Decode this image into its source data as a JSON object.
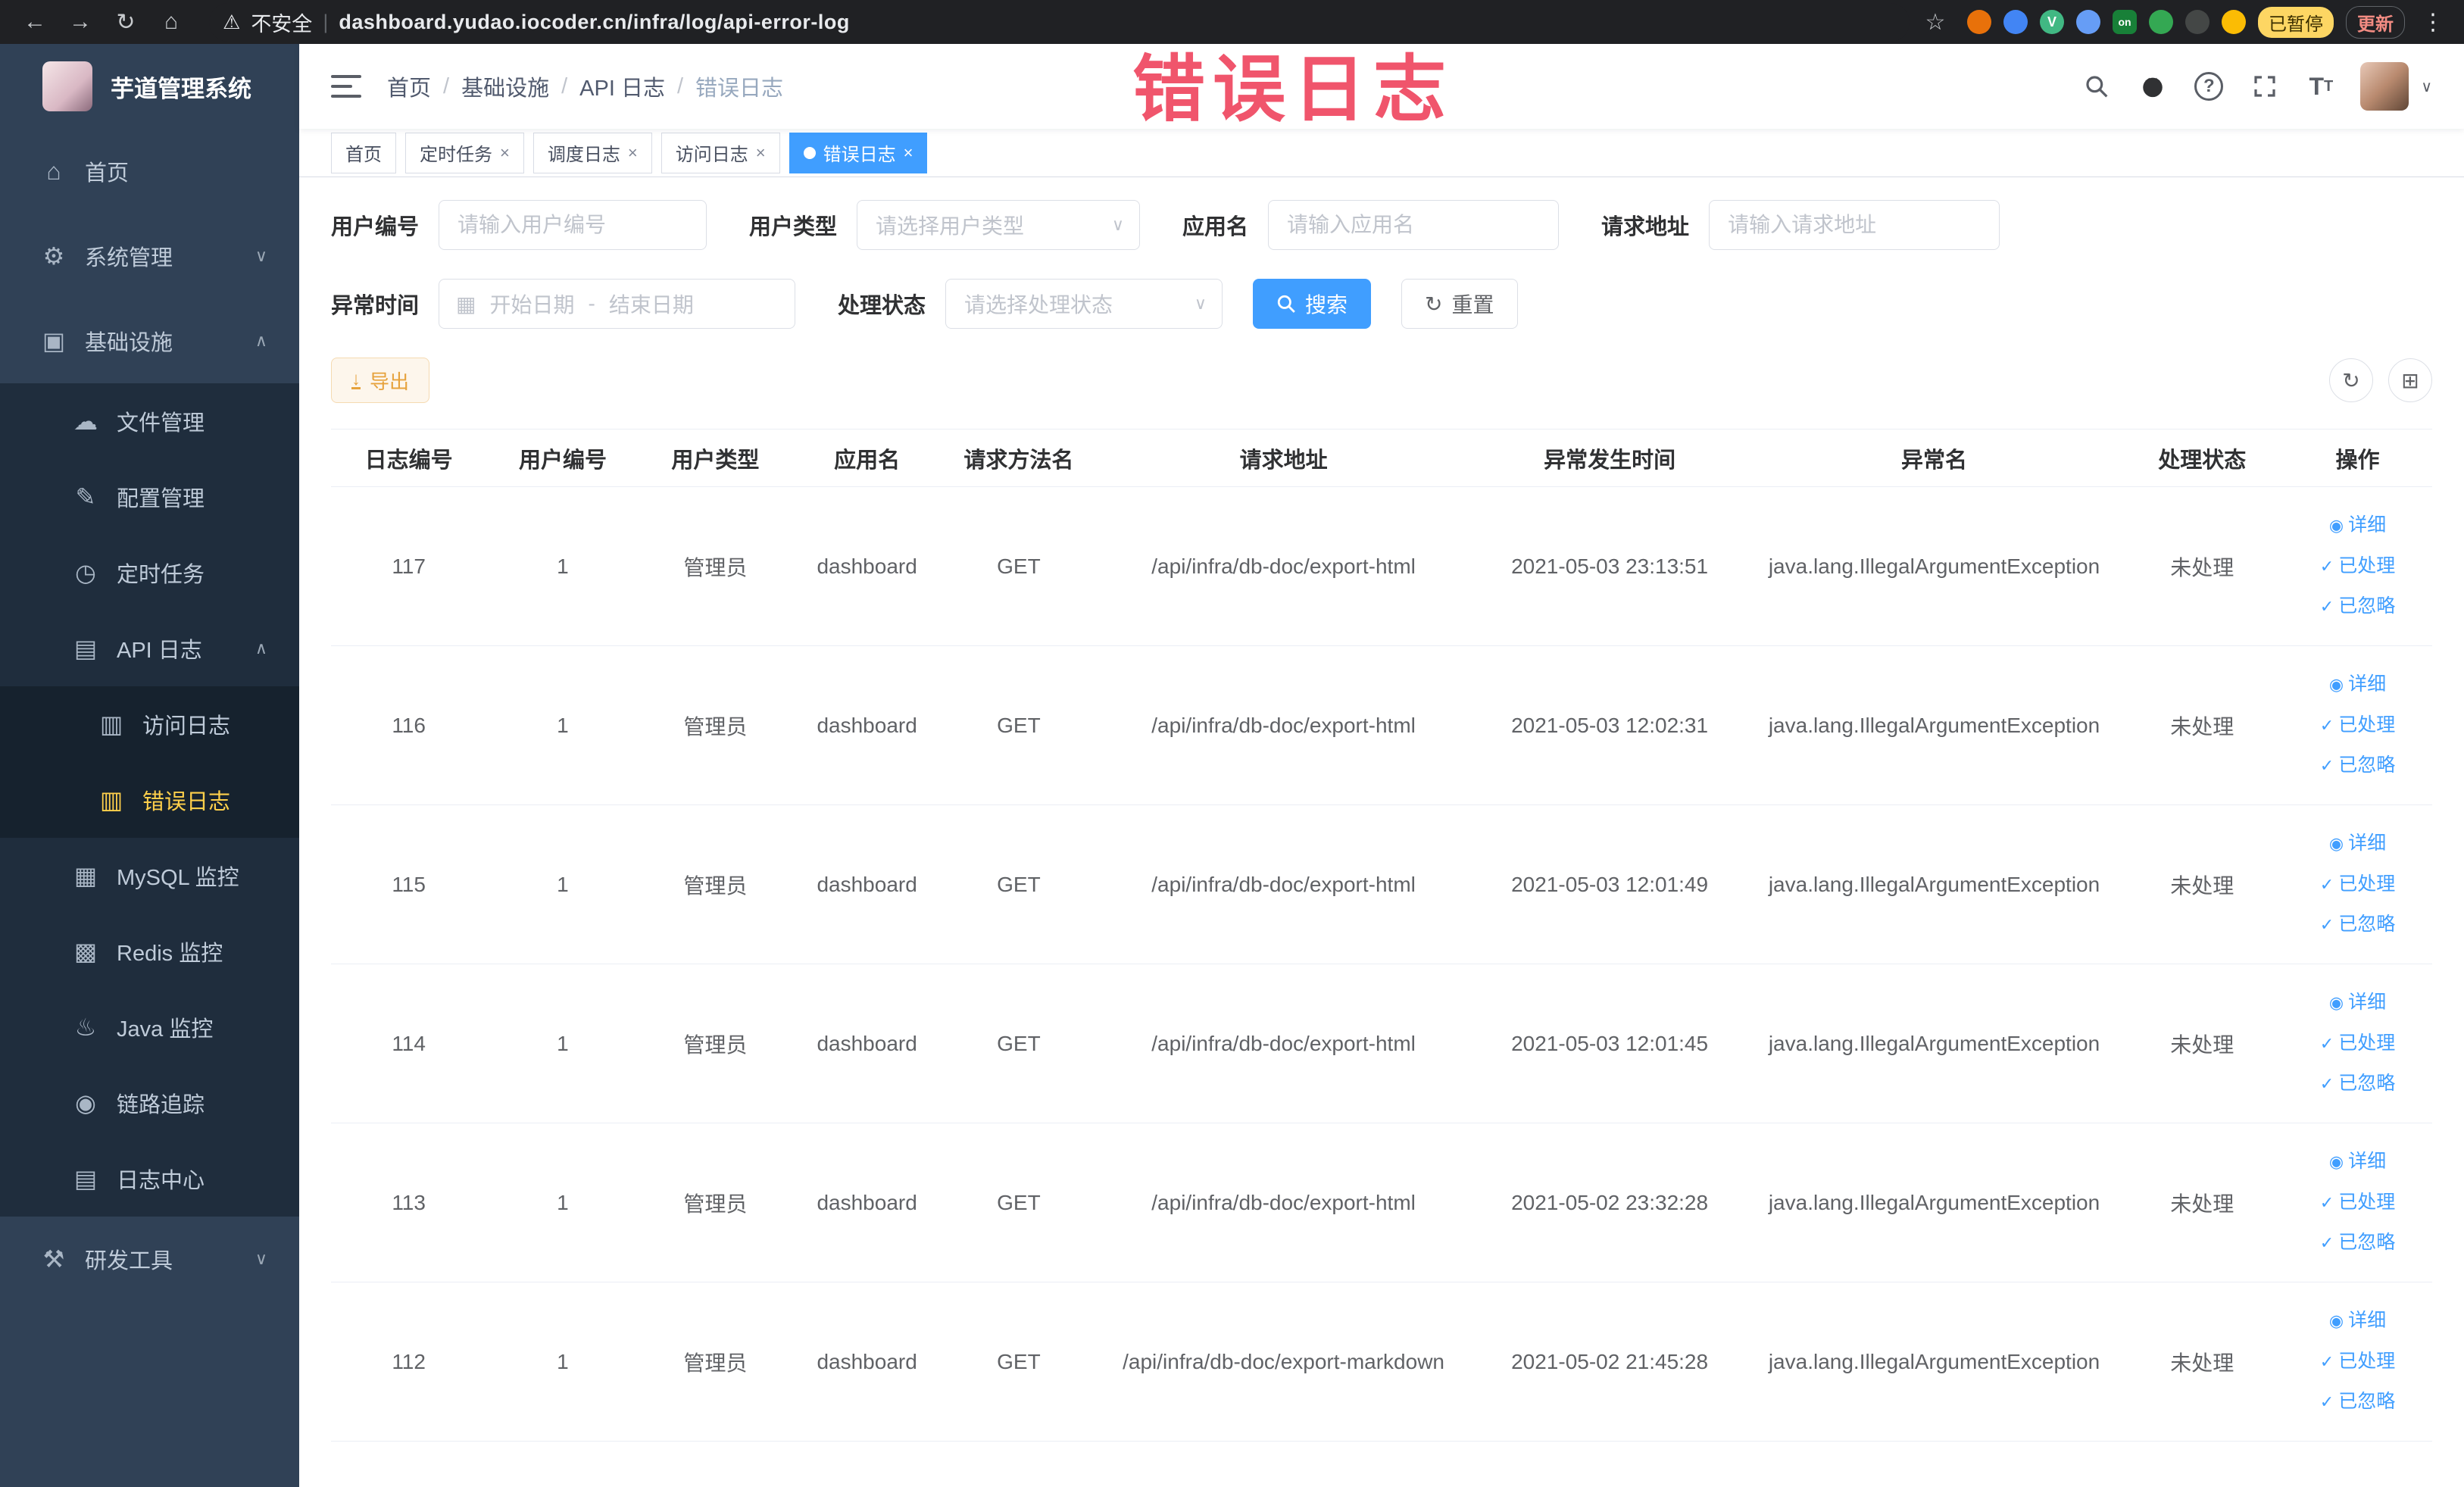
{
  "colors": {
    "accent": "#409eff",
    "sidebar_bg": "#304156",
    "submenu_bg": "#1f2d3d",
    "active_menu_text": "#ffd04b",
    "annotation_red": "#ee3e58",
    "warning_btn_text": "#e6a23c"
  },
  "browser": {
    "security_label": "不安全",
    "url": "dashboard.yudao.iocoder.cn/infra/log/api-error-log",
    "on_badge": "on",
    "paused_badge": "已暂停",
    "update_label": "更新"
  },
  "annotation": {
    "text": "错误日志"
  },
  "sidebar": {
    "logo_title": "芋道管理系统",
    "items": [
      {
        "label": "首页",
        "icon": "home-icon",
        "depth": 0
      },
      {
        "label": "系统管理",
        "icon": "gear-icon",
        "depth": 0,
        "chevron": "down"
      },
      {
        "label": "基础设施",
        "icon": "monitor-icon",
        "depth": 0,
        "chevron": "up"
      },
      {
        "label": "文件管理",
        "icon": "cloud-icon",
        "depth": 1
      },
      {
        "label": "配置管理",
        "icon": "edit-icon",
        "depth": 1
      },
      {
        "label": "定时任务",
        "icon": "clock-icon",
        "depth": 1
      },
      {
        "label": "API 日志",
        "icon": "form-icon",
        "depth": 1,
        "chevron": "up"
      },
      {
        "label": "访问日志",
        "icon": "doc-icon",
        "depth": 2
      },
      {
        "label": "错误日志",
        "icon": "doc-icon",
        "depth": 2,
        "active": true
      },
      {
        "label": "MySQL 监控",
        "icon": "grid-icon",
        "depth": 1
      },
      {
        "label": "Redis 监控",
        "icon": "layers-icon",
        "depth": 1
      },
      {
        "label": "Java 监控",
        "icon": "coffee-icon",
        "depth": 1
      },
      {
        "label": "链路追踪",
        "icon": "eye-icon",
        "depth": 1
      },
      {
        "label": "日志中心",
        "icon": "log-icon",
        "depth": 1
      },
      {
        "label": "研发工具",
        "icon": "tool-icon",
        "depth": 0,
        "chevron": "down"
      }
    ]
  },
  "header": {
    "breadcrumb": [
      {
        "label": "首页"
      },
      {
        "label": "基础设施"
      },
      {
        "label": "API 日志"
      },
      {
        "label": "错误日志",
        "current": true
      }
    ]
  },
  "tabs": [
    {
      "label": "首页",
      "closable": false,
      "active": false
    },
    {
      "label": "定时任务",
      "closable": true,
      "active": false
    },
    {
      "label": "调度日志",
      "closable": true,
      "active": false
    },
    {
      "label": "访问日志",
      "closable": true,
      "active": false
    },
    {
      "label": "错误日志",
      "closable": true,
      "active": true
    }
  ],
  "filters": {
    "user_id": {
      "label": "用户编号",
      "placeholder": "请输入用户编号"
    },
    "user_type": {
      "label": "用户类型",
      "placeholder": "请选择用户类型"
    },
    "app_name": {
      "label": "应用名",
      "placeholder": "请输入应用名"
    },
    "request_url": {
      "label": "请求地址",
      "placeholder": "请输入请求地址"
    },
    "exception_time": {
      "label": "异常时间",
      "start_placeholder": "开始日期",
      "separator": "-",
      "end_placeholder": "结束日期"
    },
    "process_status": {
      "label": "处理状态",
      "placeholder": "请选择处理状态"
    },
    "search_label": "搜索",
    "reset_label": "重置"
  },
  "toolbar": {
    "export_label": "导出"
  },
  "table": {
    "columns": [
      {
        "key": "log_id",
        "label": "日志编号"
      },
      {
        "key": "user_id",
        "label": "用户编号"
      },
      {
        "key": "user_type",
        "label": "用户类型"
      },
      {
        "key": "app_name",
        "label": "应用名"
      },
      {
        "key": "method",
        "label": "请求方法名"
      },
      {
        "key": "url",
        "label": "请求地址"
      },
      {
        "key": "time",
        "label": "异常发生时间"
      },
      {
        "key": "exception",
        "label": "异常名"
      },
      {
        "key": "status",
        "label": "处理状态"
      },
      {
        "key": "actions",
        "label": "操作"
      }
    ],
    "rows": [
      {
        "log_id": "117",
        "user_id": "1",
        "user_type": "管理员",
        "app_name": "dashboard",
        "method": "GET",
        "url": "/api/infra/db-doc/export-html",
        "time": "2021-05-03 23:13:51",
        "exception": "java.lang.IllegalArgumentException",
        "status": "未处理"
      },
      {
        "log_id": "116",
        "user_id": "1",
        "user_type": "管理员",
        "app_name": "dashboard",
        "method": "GET",
        "url": "/api/infra/db-doc/export-html",
        "time": "2021-05-03 12:02:31",
        "exception": "java.lang.IllegalArgumentException",
        "status": "未处理"
      },
      {
        "log_id": "115",
        "user_id": "1",
        "user_type": "管理员",
        "app_name": "dashboard",
        "method": "GET",
        "url": "/api/infra/db-doc/export-html",
        "time": "2021-05-03 12:01:49",
        "exception": "java.lang.IllegalArgumentException",
        "status": "未处理"
      },
      {
        "log_id": "114",
        "user_id": "1",
        "user_type": "管理员",
        "app_name": "dashboard",
        "method": "GET",
        "url": "/api/infra/db-doc/export-html",
        "time": "2021-05-03 12:01:45",
        "exception": "java.lang.IllegalArgumentException",
        "status": "未处理"
      },
      {
        "log_id": "113",
        "user_id": "1",
        "user_type": "管理员",
        "app_name": "dashboard",
        "method": "GET",
        "url": "/api/infra/db-doc/export-html",
        "time": "2021-05-02 23:32:28",
        "exception": "java.lang.IllegalArgumentException",
        "status": "未处理"
      },
      {
        "log_id": "112",
        "user_id": "1",
        "user_type": "管理员",
        "app_name": "dashboard",
        "method": "GET",
        "url": "/api/infra/db-doc/export-markdown",
        "time": "2021-05-02 21:45:28",
        "exception": "java.lang.IllegalArgumentException",
        "status": "未处理"
      }
    ],
    "row_actions": [
      {
        "name": "detail",
        "label": "详细",
        "icon": "eye-icon"
      },
      {
        "name": "processed",
        "label": "已处理",
        "icon": "check-icon"
      },
      {
        "name": "ignore",
        "label": "已忽略",
        "icon": "check-icon"
      }
    ]
  }
}
